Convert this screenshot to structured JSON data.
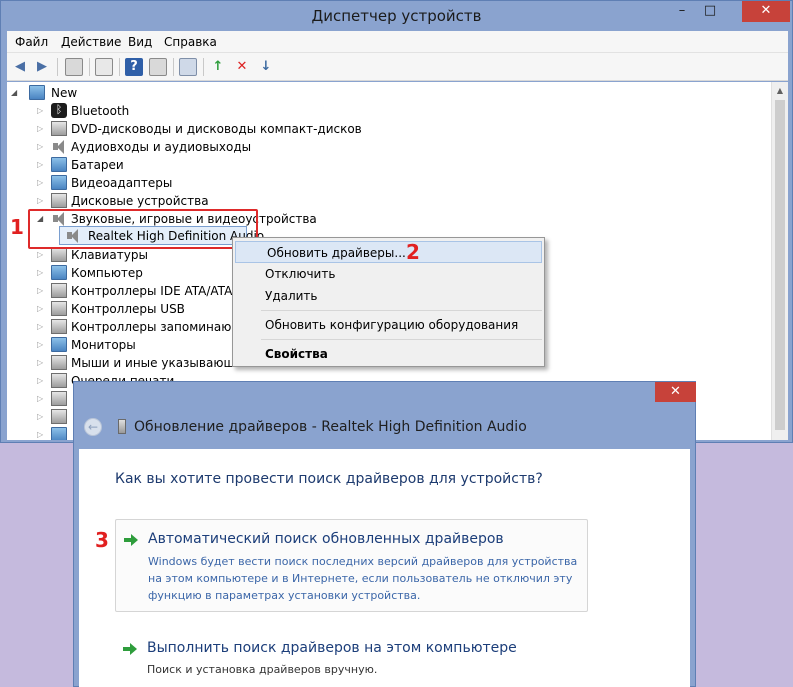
{
  "device_manager": {
    "title": "Диспетчер устройств",
    "controls": {
      "minimize": "–",
      "maximize": "□",
      "close": "✕"
    },
    "menu": [
      "Файл",
      "Действие",
      "Вид",
      "Справка"
    ],
    "toolbar_icons": [
      "back-icon",
      "forward-icon",
      "properties-icon",
      "list-icon",
      "help-icon",
      "show-hidden-icon",
      "scan-hardware-icon",
      "update-driver-icon",
      "uninstall-device-icon",
      "disable-device-icon"
    ],
    "tree": {
      "root": "New",
      "items": [
        {
          "label": "Bluetooth",
          "icon": "bluetooth-icon"
        },
        {
          "label": "DVD-дисководы и дисководы компакт-дисков",
          "icon": "dvd-drive-icon"
        },
        {
          "label": "Аудиовходы и аудиовыходы",
          "icon": "audio-io-icon"
        },
        {
          "label": "Батареи",
          "icon": "battery-icon"
        },
        {
          "label": "Видеоадаптеры",
          "icon": "display-adapter-icon"
        },
        {
          "label": "Дисковые устройства",
          "icon": "disk-drive-icon"
        },
        {
          "label": "Звуковые, игровые и видеоустройства",
          "icon": "speaker-icon",
          "expanded": true
        },
        {
          "label": "Realtek High Definition Audio",
          "icon": "speaker-icon",
          "child": true,
          "selected": true
        },
        {
          "label": "Клавиатуры",
          "icon": "keyboard-icon"
        },
        {
          "label": "Компьютер",
          "icon": "computer-icon"
        },
        {
          "label": "Контроллеры IDE ATA/ATAPI",
          "icon": "ide-controller-icon"
        },
        {
          "label": "Контроллеры USB",
          "icon": "usb-controller-icon"
        },
        {
          "label": "Контроллеры запоминающи",
          "icon": "storage-controller-icon"
        },
        {
          "label": "Мониторы",
          "icon": "monitor-icon"
        },
        {
          "label": "Мыши и иные указывающие",
          "icon": "mouse-icon"
        },
        {
          "label": "Очереди печати",
          "icon": "print-queue-icon"
        },
        {
          "label": "",
          "icon": "device-icon"
        },
        {
          "label": "",
          "icon": "device-icon"
        },
        {
          "label": "",
          "icon": "device-icon"
        }
      ]
    },
    "context_menu": {
      "update": "Обновить драйверы...",
      "disable": "Отключить",
      "delete": "Удалить",
      "scan": "Обновить конфигурацию оборудования",
      "properties": "Свойства"
    }
  },
  "annotations": {
    "step1": "1",
    "step2": "2",
    "step3": "3",
    "color": "#e12020"
  },
  "update_driver_dialog": {
    "title": "Обновление драйверов - Realtek High Definition Audio",
    "close": "✕",
    "back": "←",
    "question": "Как вы хотите провести поиск драйверов для устройств?",
    "options": [
      {
        "title": "Автоматический поиск обновленных драйверов",
        "desc": "Windows будет вести поиск последних версий драйверов для устройства на этом компьютере и в Интернете, если пользователь не отключил эту функцию в параметрах установки устройства."
      },
      {
        "title": "Выполнить поиск драйверов на этом компьютере",
        "desc": "Поиск и установка драйверов вручную."
      }
    ]
  }
}
